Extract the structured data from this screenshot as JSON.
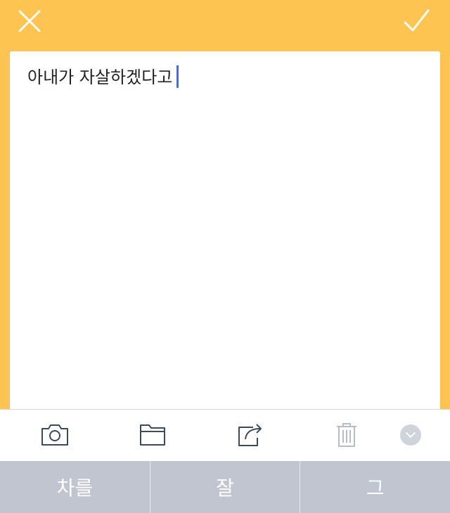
{
  "note": {
    "text": "아내가 자살하겠다고"
  },
  "header": {
    "close_icon": "close-icon",
    "confirm_icon": "check-icon"
  },
  "toolbar": {
    "items": [
      {
        "icon": "camera-icon"
      },
      {
        "icon": "folder-icon"
      },
      {
        "icon": "share-icon"
      },
      {
        "icon": "trash-icon"
      },
      {
        "icon": "chevron-down-circle-icon"
      }
    ]
  },
  "keyboard": {
    "suggestions": [
      "차를",
      "잘",
      "그"
    ]
  },
  "colors": {
    "background": "#fec452",
    "card": "#ffffff",
    "caret": "#3c6ff0",
    "suggestion_bar": "#c0c5d0",
    "icon": "#3b4a5c"
  }
}
